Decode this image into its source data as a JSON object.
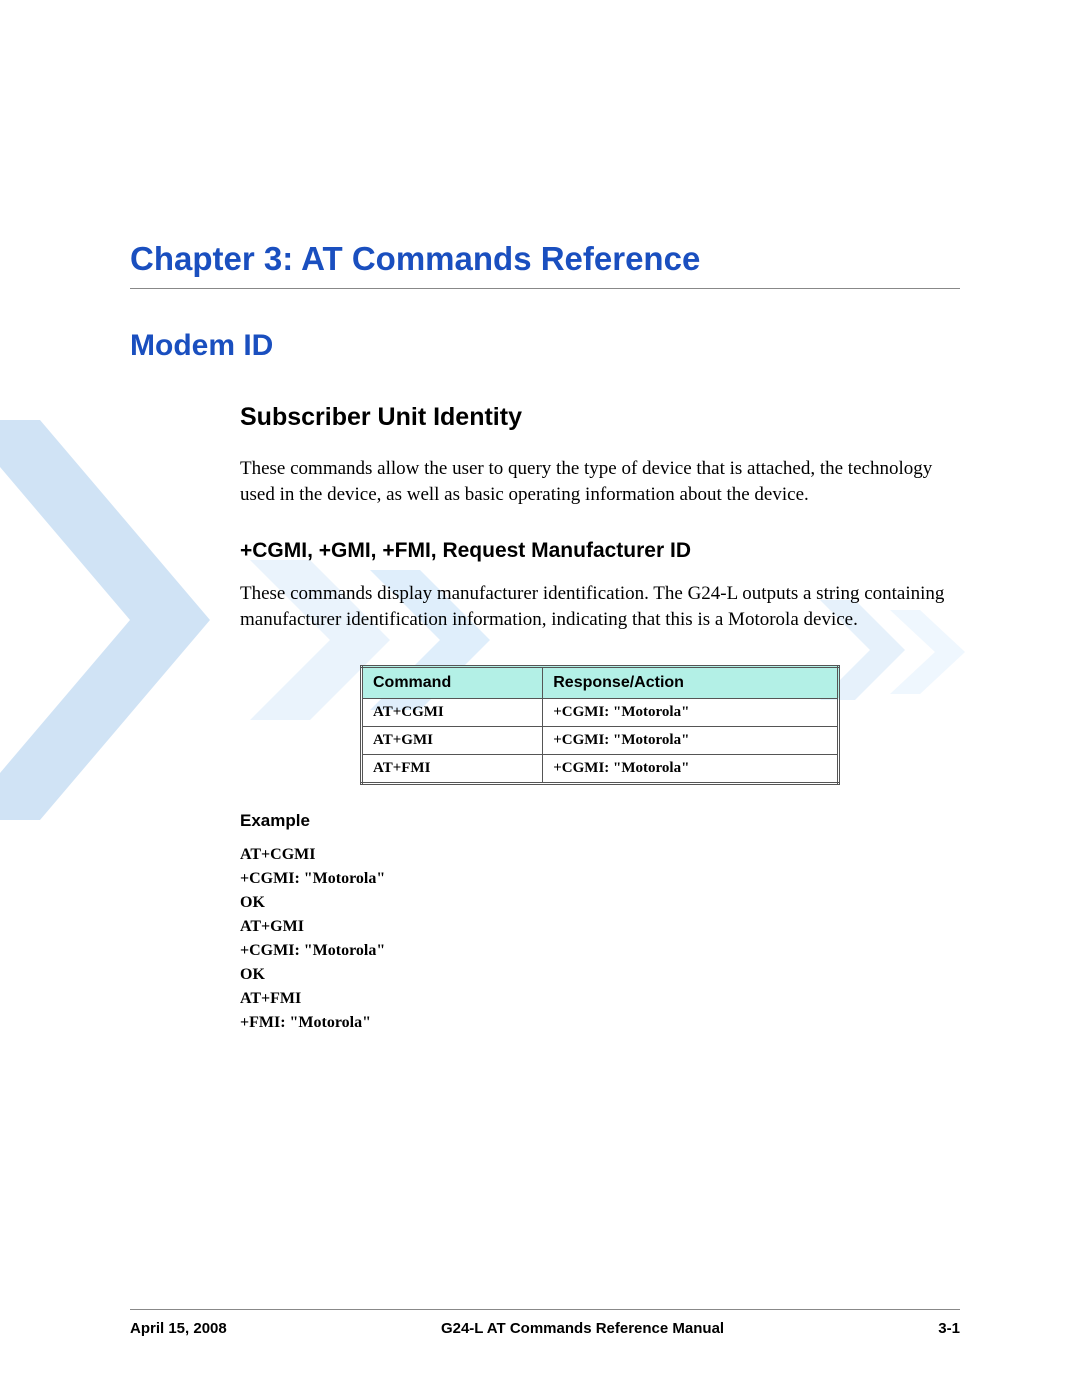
{
  "chapter_title": "Chapter 3: AT Commands Reference",
  "section_title": "Modem ID",
  "subsection_title": "Subscriber Unit Identity",
  "subsection_body": "These commands allow the user to query the type of device that is attached, the technology used in the device, as well as basic operating information about the device.",
  "subsubsection_title": "+CGMI, +GMI, +FMI, Request Manufacturer ID",
  "subsubsection_body": "These commands display manufacturer identification. The G24-L outputs a string containing manufacturer identification information, indicating that this is a Motorola device.",
  "table": {
    "headers": [
      "Command",
      "Response/Action"
    ],
    "rows": [
      [
        "AT+CGMI",
        "+CGMI: \"Motorola\""
      ],
      [
        "AT+GMI",
        "+CGMI: \"Motorola\""
      ],
      [
        "AT+FMI",
        "+CGMI: \"Motorola\""
      ]
    ]
  },
  "example_title": "Example",
  "example_block": "AT+CGMI\n+CGMI: \"Motorola\"\nOK\nAT+GMI\n+CGMI: \"Motorola\"\nOK\nAT+FMI\n+FMI: \"Motorola\"",
  "footer": {
    "left": "April 15, 2008",
    "center": "G24-L AT Commands Reference Manual",
    "right": "3-1"
  }
}
